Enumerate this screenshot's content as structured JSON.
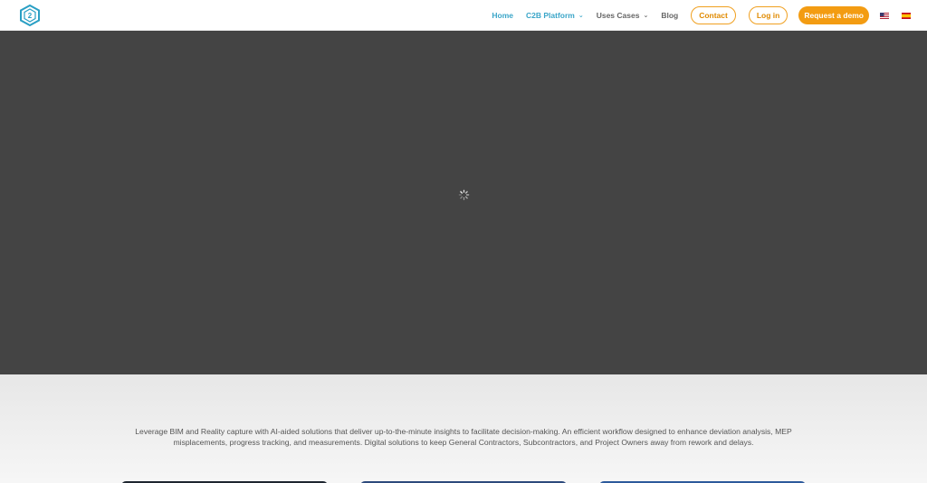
{
  "header": {
    "logo_icon": "c2b-hexagon-logo-icon",
    "nav": [
      {
        "label": "Home",
        "active": true,
        "dropdown": false
      },
      {
        "label": "C2B Platform",
        "active": true,
        "dropdown": true
      },
      {
        "label": "Uses Cases",
        "active": false,
        "dropdown": true
      },
      {
        "label": "Blog",
        "active": false,
        "dropdown": false
      }
    ],
    "contact_label": "Contact",
    "login_label": "Log in",
    "demo_label": "Request a demo",
    "flags": [
      "us-flag-icon",
      "es-flag-icon"
    ]
  },
  "hero": {
    "spinner_icon": "loading-spinner-icon"
  },
  "intro": {
    "text": "Leverage BIM and Reality capture with AI-aided solutions that deliver up-to-the-minute insights to facilitate decision-making. An efficient workflow designed to enhance deviation analysis, MEP misplacements, progress tracking, and measurements. Digital solutions to keep General Contractors, Subcontractors, and Project Owners away from rework and delays."
  },
  "colors": {
    "accent_blue": "#3aa5c8",
    "accent_orange": "#f39c12",
    "hero_bg": "#444444",
    "text_gray": "#666666"
  }
}
